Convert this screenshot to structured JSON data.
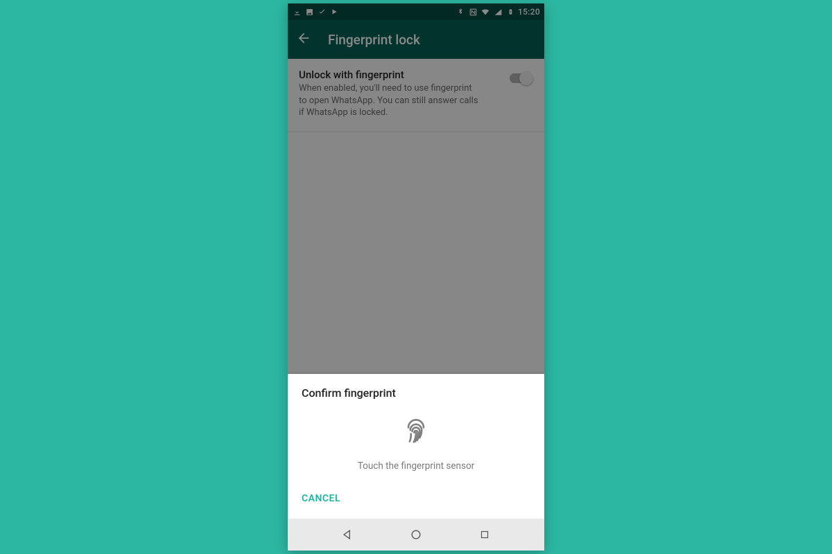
{
  "statusbar": {
    "time": "15:20",
    "left_icons": [
      "download-icon",
      "image-icon",
      "check-icon",
      "play-icon"
    ],
    "right_icons": [
      "bluetooth-icon",
      "nfc-icon",
      "wifi-icon",
      "signal-icon",
      "battery-charging-icon"
    ]
  },
  "appbar": {
    "title": "Fingerprint lock",
    "back_icon": "arrow-back-icon"
  },
  "settings": {
    "unlock": {
      "title": "Unlock with fingerprint",
      "subtitle": "When enabled, you'll need to use fingerprint to open WhatsApp. You can still answer calls if WhatsApp is locked.",
      "enabled": false
    }
  },
  "dialog": {
    "title": "Confirm fingerprint",
    "instruction": "Touch the fingerprint sensor",
    "icon": "fingerprint-icon",
    "cancel_label": "CANCEL"
  },
  "navbar": {
    "back": "triangle-back-icon",
    "home": "circle-home-icon",
    "recents": "square-recents-icon"
  },
  "colors": {
    "accent": "#1db6a0",
    "appbar": "#075e54",
    "statusbar": "#054d44",
    "background": "#2cb7a2"
  }
}
